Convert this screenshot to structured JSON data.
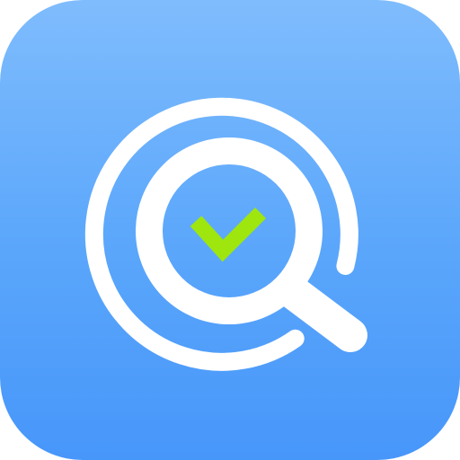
{
  "app_icon": {
    "icon_name": "search-check-icon",
    "background_gradient": [
      "#7fbcfd",
      "#5aa6fb",
      "#4796fa"
    ],
    "ring_color": "#ffffff",
    "check_color": "#9ee60e"
  }
}
